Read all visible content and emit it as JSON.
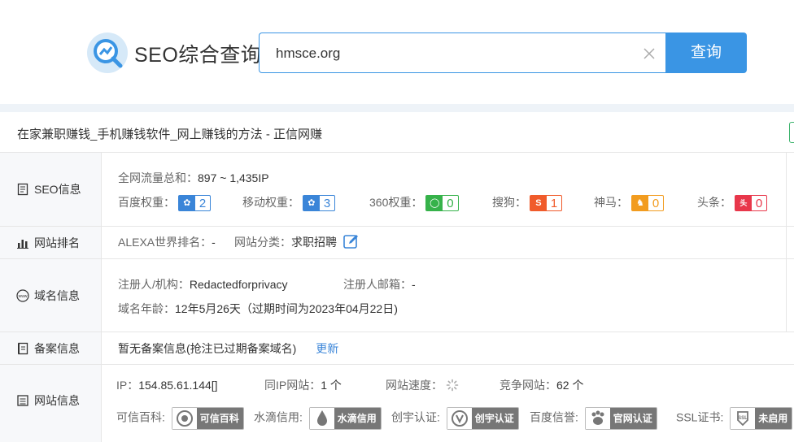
{
  "header": {
    "logo_text": "SEO综合查询",
    "search_value": "hmsce.org",
    "search_button": "查询"
  },
  "site_title": "在家兼职赚钱_手机赚钱软件_网上赚钱的方法 - 正信网赚",
  "seo": {
    "label": "SEO信息",
    "traffic_label": "全网流量总和：",
    "traffic_value": "897 ~ 1,435IP",
    "weights": [
      {
        "label": "百度权重：",
        "value": "2",
        "color": "#3a85d8"
      },
      {
        "label": "移动权重：",
        "value": "3",
        "color": "#3a85d8"
      },
      {
        "label": "360权重：",
        "value": "0",
        "color": "#36b24a"
      },
      {
        "label": "搜狗：",
        "value": "1",
        "color": "#f05b2b"
      },
      {
        "label": "神马：",
        "value": "0",
        "color": "#f29c1f"
      },
      {
        "label": "头条：",
        "value": "0",
        "color": "#e8374b"
      }
    ]
  },
  "rank": {
    "label": "网站排名",
    "alexa_label": "ALEXA世界排名：",
    "alexa_value": "-",
    "category_label": "网站分类：",
    "category_value": "求职招聘"
  },
  "domain": {
    "label": "域名信息",
    "registrant_label": "注册人/机构：",
    "registrant_value": "Redactedforprivacy",
    "email_label": "注册人邮箱：",
    "email_value": "-",
    "age_label": "域名年龄：",
    "age_value": "12年5月26天（过期时间为2023年04月22日)"
  },
  "beian": {
    "label": "备案信息",
    "text": "暂无备案信息(抢注已过期备案域名)",
    "update": "更新"
  },
  "site": {
    "label": "网站信息",
    "ip_label": "IP：",
    "ip_value": "154.85.61.144[]",
    "same_ip_label": "同IP网站：",
    "same_ip_value": "1 个",
    "speed_label": "网站速度：",
    "compete_label": "竞争网站：",
    "compete_value": "62 个",
    "certs": [
      {
        "label": "可信百科:",
        "badge": "可信百科"
      },
      {
        "label": "水滴信用:",
        "badge": "水滴信用"
      },
      {
        "label": "创宇认证:",
        "badge": "创宇认证"
      },
      {
        "label": "百度信誉:",
        "badge": "官网认证"
      },
      {
        "label": "SSL证书:",
        "badge": "未启用"
      }
    ]
  }
}
